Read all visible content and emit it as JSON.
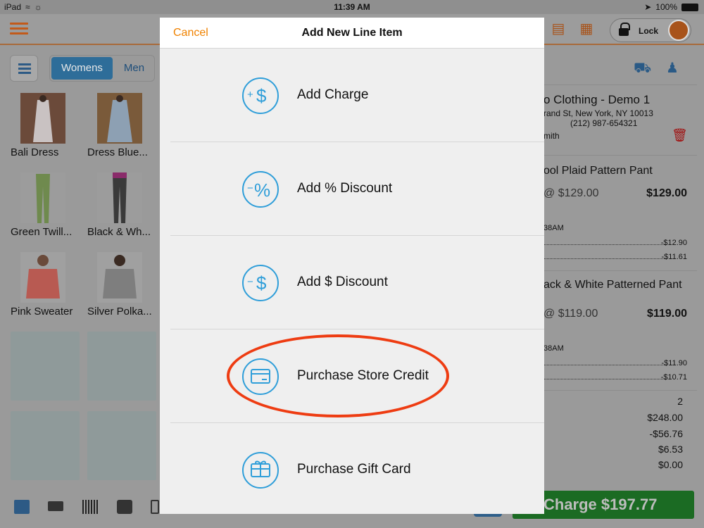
{
  "status_bar": {
    "device": "iPad",
    "time": "11:39 AM",
    "battery": "100%"
  },
  "categories": {
    "tabs": [
      "Womens",
      "Men"
    ]
  },
  "products": [
    {
      "name": "Bali Dress"
    },
    {
      "name": "Dress Blue..."
    },
    {
      "name": "Green Twill..."
    },
    {
      "name": "Black & Wh..."
    },
    {
      "name": "Pink Sweater"
    },
    {
      "name": "Silver Polka..."
    }
  ],
  "toolbar": {
    "lock_label": "Lock"
  },
  "cart": {
    "store_name": "o Clothing - Demo 1",
    "store_address": "rand St, New York, NY 10013",
    "store_phone": "(212) 987-654321",
    "customer": "mith",
    "items": [
      {
        "name": "ool Plaid Pattern Pant",
        "unit_price": "@ $129.00",
        "total": "$129.00",
        "time": "38AM",
        "discounts": [
          "-$12.90",
          "-$11.61"
        ]
      },
      {
        "name": "ack & White Patterned Pant",
        "unit_price": "@ $119.00",
        "total": "$119.00",
        "time": "38AM",
        "discounts": [
          "-$11.90",
          "-$10.71"
        ]
      }
    ],
    "summary": [
      "2",
      "$248.00",
      "-$56.76",
      "$6.53",
      "$0.00"
    ],
    "charge_label": "Charge $197.77"
  },
  "modal": {
    "cancel_label": "Cancel",
    "title": "Add New Line Item",
    "options": [
      {
        "label": "Add Charge",
        "icon": "add-charge-icon"
      },
      {
        "label": "Add % Discount",
        "icon": "percent-discount-icon"
      },
      {
        "label": "Add $ Discount",
        "icon": "dollar-discount-icon"
      },
      {
        "label": "Purchase Store Credit",
        "icon": "store-credit-card-icon"
      },
      {
        "label": "Purchase Gift Card",
        "icon": "gift-card-icon"
      }
    ]
  },
  "colors": {
    "accent_orange": "#f08200",
    "icon_blue": "#2f9ed9",
    "annotation_red": "#ee3c12",
    "charge_green": "#1b6b23"
  }
}
